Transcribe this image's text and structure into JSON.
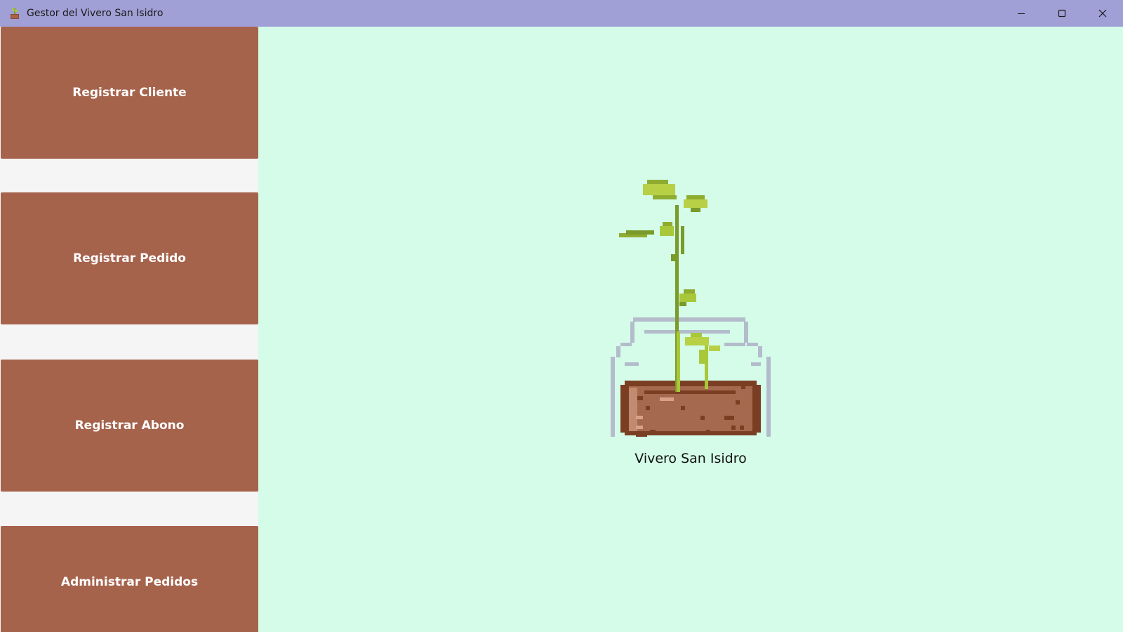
{
  "window": {
    "title": "Gestor del Vivero San Isidro",
    "app_icon": "potted-plant-icon",
    "controls": [
      "minimize-icon",
      "maximize-icon",
      "close-icon"
    ]
  },
  "sidebar": {
    "items": [
      {
        "label": "Registrar Cliente"
      },
      {
        "label": "Registrar Pedido"
      },
      {
        "label": "Registrar Abono"
      },
      {
        "label": "Administrar Pedidos"
      }
    ]
  },
  "main": {
    "illustration": "potted-plant-in-jar-icon",
    "caption": "Vivero San Isidro"
  },
  "colors": {
    "titlebar": "#a0a0d6",
    "nav_button": "#a6634c",
    "main_background": "#d4fce9",
    "sidebar_background": "#f5f5f5"
  }
}
